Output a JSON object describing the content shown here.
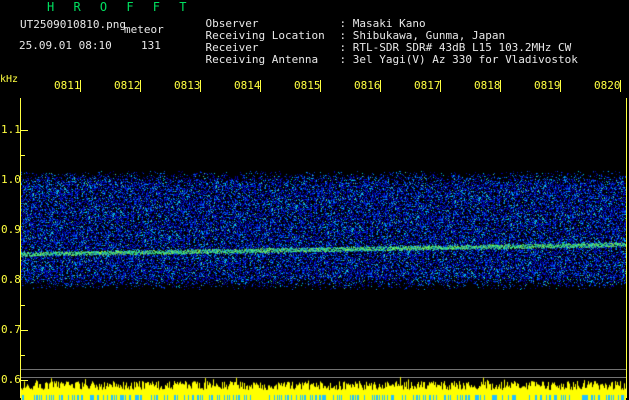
{
  "app": {
    "title": "H R O F F T"
  },
  "file": {
    "name": "UT2509010810.png",
    "mode": "meteor"
  },
  "timestamp": {
    "datetime": "25.09.01 08:10",
    "count": "131"
  },
  "info": [
    {
      "label": "Observer",
      "value": ": Masaki Kano"
    },
    {
      "label": "Receiving Location",
      "value": ": Shibukawa, Gunma, Japan"
    },
    {
      "label": "Receiver",
      "value": ": RTL-SDR SDR# 43dB L15 103.2MHz CW"
    },
    {
      "label": "Receiving Antenna",
      "value": ": 3el Yagi(V) Az 330 for Vladivostok"
    }
  ],
  "axis": {
    "unit": "kHz",
    "time_ticks": [
      "0811",
      "0812",
      "0813",
      "0814",
      "0815",
      "0816",
      "0817",
      "0818",
      "0819",
      "0820"
    ],
    "freq_ticks": [
      "1.1",
      "1.0",
      "0.9",
      "0.8",
      "0.7",
      "0.6"
    ]
  },
  "colors": {
    "tick": "#ffff40",
    "title": "#00e060",
    "text": "#e8e8e8",
    "noise": "#1030d0",
    "signal": "#40ff80",
    "level": "#ffff00"
  }
}
